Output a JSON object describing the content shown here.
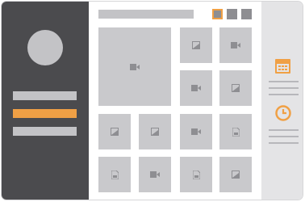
{
  "sidebar": {
    "avatar": "avatar-placeholder",
    "items": [
      {
        "id": "nav-item-1",
        "active": false
      },
      {
        "id": "nav-item-2",
        "active": true
      },
      {
        "id": "nav-item-3",
        "active": false
      }
    ]
  },
  "toolbar": {
    "view_buttons": [
      "grid-view",
      "list-view",
      "detail-view"
    ],
    "active_view": "grid-view"
  },
  "gallery": {
    "tiles": [
      {
        "kind": "video",
        "icon": "video-icon",
        "size": "large"
      },
      {
        "kind": "image",
        "icon": "image-icon"
      },
      {
        "kind": "video",
        "icon": "video-icon"
      },
      {
        "kind": "video",
        "icon": "video-icon"
      },
      {
        "kind": "image",
        "icon": "image-icon"
      },
      {
        "kind": "image",
        "icon": "image-icon"
      },
      {
        "kind": "image",
        "icon": "image-icon"
      },
      {
        "kind": "video",
        "icon": "video-icon"
      },
      {
        "kind": "document",
        "icon": "document-icon"
      },
      {
        "kind": "document",
        "icon": "document-icon"
      },
      {
        "kind": "video",
        "icon": "video-icon"
      },
      {
        "kind": "document",
        "icon": "document-icon"
      },
      {
        "kind": "image",
        "icon": "image-icon"
      }
    ]
  },
  "right_panel": {
    "sections": [
      {
        "icon": "calendar-icon"
      },
      {
        "icon": "clock-icon"
      }
    ]
  },
  "colors": {
    "accent": "#f0a045",
    "sidebar": "#4b4b4e",
    "placeholder": "#c3c3c6",
    "tile": "#c9c9cc",
    "icon": "#8e8e92",
    "panel": "#e4e4e6"
  }
}
